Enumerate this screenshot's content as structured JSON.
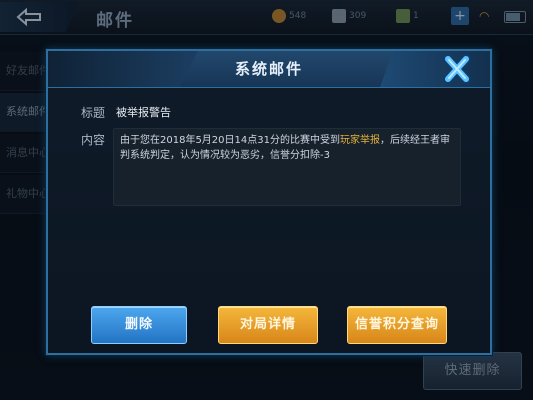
{
  "background": {
    "title": "邮件",
    "resources": [
      "548",
      "309",
      "1"
    ],
    "sidebar": [
      "好友邮件",
      "系统邮件",
      "消息中心",
      "礼物中心"
    ],
    "quick_delete": "快速删除"
  },
  "modal": {
    "title": "系统邮件",
    "subject_label": "标题",
    "subject_value": "被举报警告",
    "content_label": "内容",
    "content_part1": "由于您在2018年5月20日14点31分的比赛中受到",
    "content_highlight": "玩家举报",
    "content_part2": "，后续经王者审判系统判定，认为情况较为恶劣，信誉分扣除-3",
    "buttons": {
      "delete": "删除",
      "match_details": "对局详情",
      "credit_query": "信誉积分查询"
    }
  },
  "colors": {
    "accent_blue": "#2d6fa0",
    "highlight": "#e3b13d",
    "gold_button": "#f4b73b",
    "blue_button": "#4da7ee"
  }
}
